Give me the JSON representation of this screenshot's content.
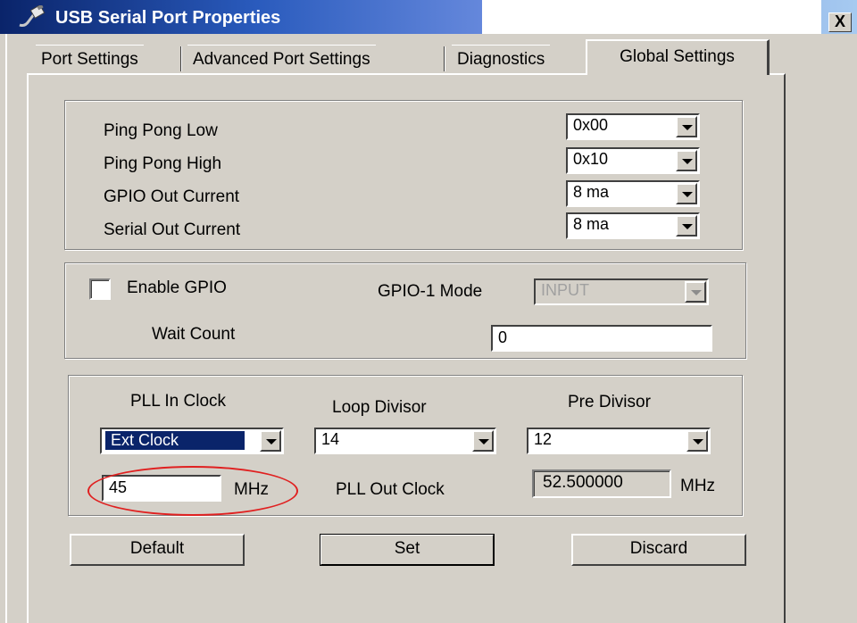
{
  "window": {
    "title": "USB Serial Port Properties",
    "close_label": "X"
  },
  "tabs": [
    {
      "label": "Port Settings"
    },
    {
      "label": "Advanced Port Settings"
    },
    {
      "label": "Diagnostics"
    },
    {
      "label": "Global Settings",
      "active": true
    }
  ],
  "ping_group": {
    "ping_pong_low": {
      "label": "Ping Pong Low",
      "value": "0x00"
    },
    "ping_pong_high": {
      "label": "Ping Pong High",
      "value": "0x10"
    },
    "gpio_out_current": {
      "label": "GPIO Out Current",
      "value": "8 ma"
    },
    "serial_out_current": {
      "label": "Serial Out Current",
      "value": "8 ma"
    }
  },
  "gpio_group": {
    "enable_gpio": {
      "label": "Enable GPIO",
      "checked": false
    },
    "gpio1_mode": {
      "label": "GPIO-1 Mode",
      "value": "INPUT",
      "disabled": true
    },
    "wait_count": {
      "label": "Wait Count",
      "value": "0"
    }
  },
  "pll_group": {
    "pll_in_clock": {
      "label": "PLL In Clock",
      "value": "Ext Clock"
    },
    "loop_divisor": {
      "label": "Loop Divisor",
      "value": "14"
    },
    "pre_divisor": {
      "label": "Pre Divisor",
      "value": "12"
    },
    "ext_clock_freq": {
      "value": "45",
      "unit": "MHz"
    },
    "pll_out_clock": {
      "label": "PLL Out Clock",
      "value": "52.500000",
      "unit": "MHz"
    }
  },
  "buttons": {
    "default": "Default",
    "set": "Set",
    "discard": "Discard"
  },
  "colors": {
    "titlebar": "#0a246a",
    "face": "#d4d0c8",
    "highlight_ellipse": "#e02020",
    "selection": "#0a246a"
  }
}
